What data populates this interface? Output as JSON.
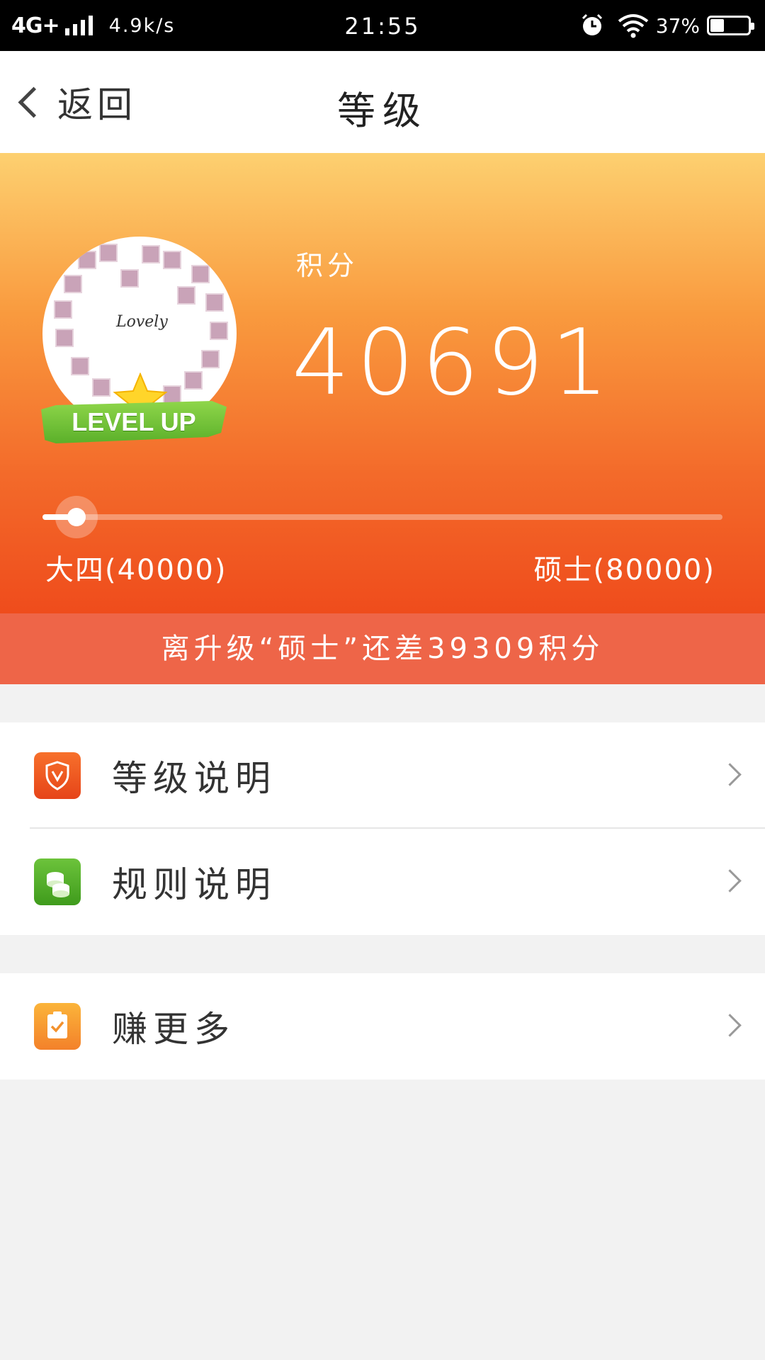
{
  "status_bar": {
    "network": "4G+",
    "speed": "4.9k/s",
    "time": "21:55",
    "battery_pct": "37%",
    "battery_level": 0.37
  },
  "nav": {
    "back_label": "返回",
    "title": "等级"
  },
  "hero": {
    "avatar_text": "Lovely",
    "badge_text": "LEVEL UP",
    "points_label": "积分",
    "points_value": "40691",
    "current_level": "大四(40000)",
    "next_level": "硕士(80000)",
    "progress_fraction": 0.05,
    "colors": {
      "top": "#fdd070",
      "bottom": "#ef4c1c"
    }
  },
  "notice": "离升级“硕士”还差39309积分",
  "menu": {
    "items": [
      {
        "label": "等级说明",
        "icon": "shield-icon"
      },
      {
        "label": "规则说明",
        "icon": "coins-icon"
      },
      {
        "label": "赚更多",
        "icon": "clipboard-check-icon"
      }
    ]
  }
}
